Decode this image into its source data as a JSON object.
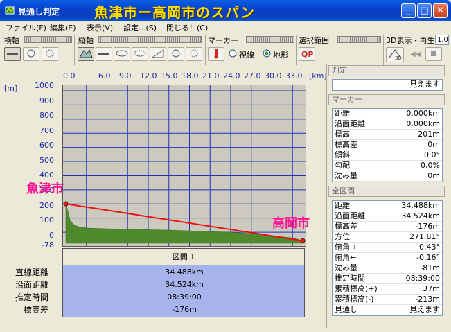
{
  "window": {
    "title": "見通し判定",
    "overlay_title": "魚津市ー高岡市のスパン",
    "buttons": {
      "minimize": "_",
      "maximize": "□",
      "close": "✕"
    }
  },
  "menu": [
    "ファイル(F)",
    "編集(E)",
    "表示(V)",
    "設定...(S)",
    "閉じる！(C)"
  ],
  "toolbar": {
    "yokojiku": "横軸",
    "tatejiku": "縦軸",
    "marker": "マーカー",
    "sentaku": "選択範囲",
    "view3d": "3D表示・再生",
    "view3d_value": "1.0",
    "radio_sightline": "視線",
    "radio_terrain": "地形",
    "btn3d": "3D"
  },
  "chart_data": {
    "type": "area",
    "xlabel_unit": "[km]",
    "ylabel_unit": "[m]",
    "x_ticks": [
      "0.0",
      "6.0",
      "9.0",
      "12.0",
      "15.0",
      "18.0",
      "21.0",
      "24.0",
      "27.0",
      "30.0",
      "33.0"
    ],
    "y_ticks": [
      "1000",
      "900",
      "800",
      "700",
      "600",
      "500",
      "400",
      "300",
      "200",
      "100",
      "0",
      "-78"
    ],
    "ylim": [
      -78,
      1000
    ],
    "xlim": [
      0,
      34.488
    ],
    "terrain": {
      "x": [
        0,
        0.3,
        0.6,
        1.0,
        1.5,
        2.0,
        3.0,
        4.0,
        6.0,
        9.0,
        12.0,
        15.0,
        18.0,
        21.0,
        24.0,
        27.0,
        30.0,
        33.0,
        34.488
      ],
      "y": [
        201,
        150,
        90,
        60,
        45,
        38,
        30,
        28,
        25,
        22,
        18,
        15,
        10,
        5,
        0,
        -10,
        -25,
        -40,
        -60
      ]
    },
    "sightline": {
      "x": [
        0,
        34.488
      ],
      "y": [
        201,
        -60
      ]
    },
    "start_label": "魚津市",
    "end_label": "高岡市"
  },
  "section": {
    "header": "区間 1",
    "rows": [
      {
        "label": "直線距離",
        "value": "34.488km"
      },
      {
        "label": "沿面距離",
        "value": "34.524km"
      },
      {
        "label": "推定時間",
        "value": "08:39:00"
      },
      {
        "label": "標高差",
        "value": "-176m"
      }
    ]
  },
  "panel": {
    "judge_header": "判定",
    "judge_value": "見えます",
    "marker_header": "マーカー",
    "marker_rows": [
      {
        "k": "距離",
        "v": "0.000km"
      },
      {
        "k": "沿面距離",
        "v": "0.000km"
      },
      {
        "k": "標高",
        "v": "201m"
      },
      {
        "k": "標高差",
        "v": "0m"
      },
      {
        "k": "傾斜",
        "v": "0.0°"
      },
      {
        "k": "勾配",
        "v": "0.0%"
      },
      {
        "k": "沈み量",
        "v": "0m"
      }
    ],
    "all_header": "全区間",
    "all_rows": [
      {
        "k": "距離",
        "v": "34.488km"
      },
      {
        "k": "沿面距離",
        "v": "34.524km"
      },
      {
        "k": "標高差",
        "v": "-176m"
      },
      {
        "k": "方位",
        "v": "271.81°"
      },
      {
        "k": "俯角→",
        "v": "0.43°"
      },
      {
        "k": "俯角←",
        "v": "-0.16°"
      },
      {
        "k": "沈み量",
        "v": "-81m"
      },
      {
        "k": "推定時間",
        "v": "08:39:00"
      },
      {
        "k": "累積標高(+)",
        "v": "37m"
      },
      {
        "k": "累積標高(-)",
        "v": "-213m"
      },
      {
        "k": "見通し",
        "v": "見えます"
      }
    ]
  },
  "colors": {
    "sightline": "#ee1111",
    "terrain": "#4f8a2c",
    "grid": "#2233bb",
    "section_bg": "#a7b4ec"
  }
}
